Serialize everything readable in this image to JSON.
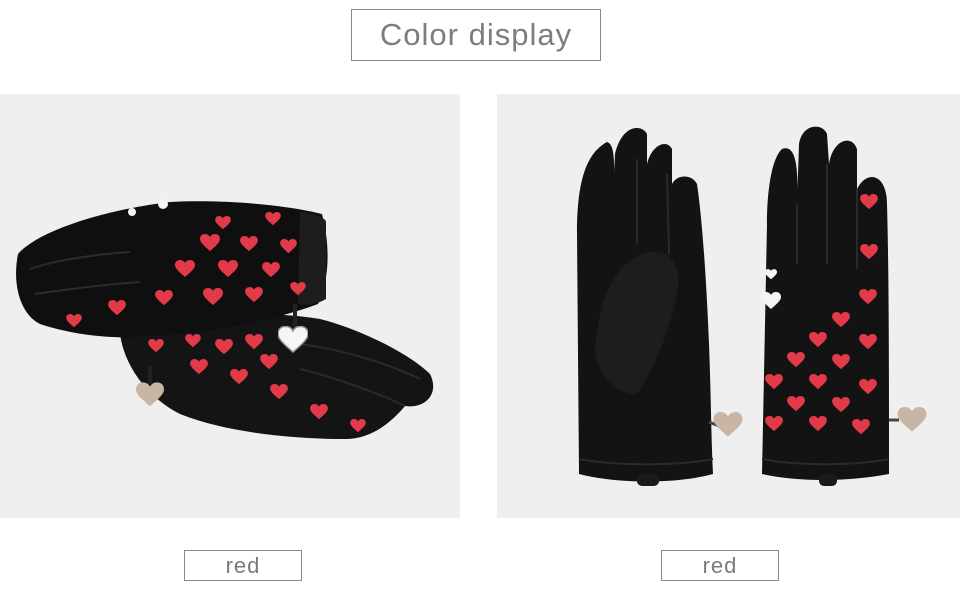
{
  "header": {
    "title": "Color display"
  },
  "products": [
    {
      "color_label": "red",
      "image": "gloves-pair-crossed-hearts-photo"
    },
    {
      "color_label": "red",
      "image": "gloves-pair-flat-hearts-photo"
    }
  ],
  "colors": {
    "glove_leather": "#111111",
    "heart_red": "#e23a48",
    "heart_white": "#f4f4f4",
    "charm_metal": "#c9b5a3",
    "photo_bg": "#efefef",
    "label_text": "#7a7a7a",
    "label_border": "#8a8a8a"
  }
}
